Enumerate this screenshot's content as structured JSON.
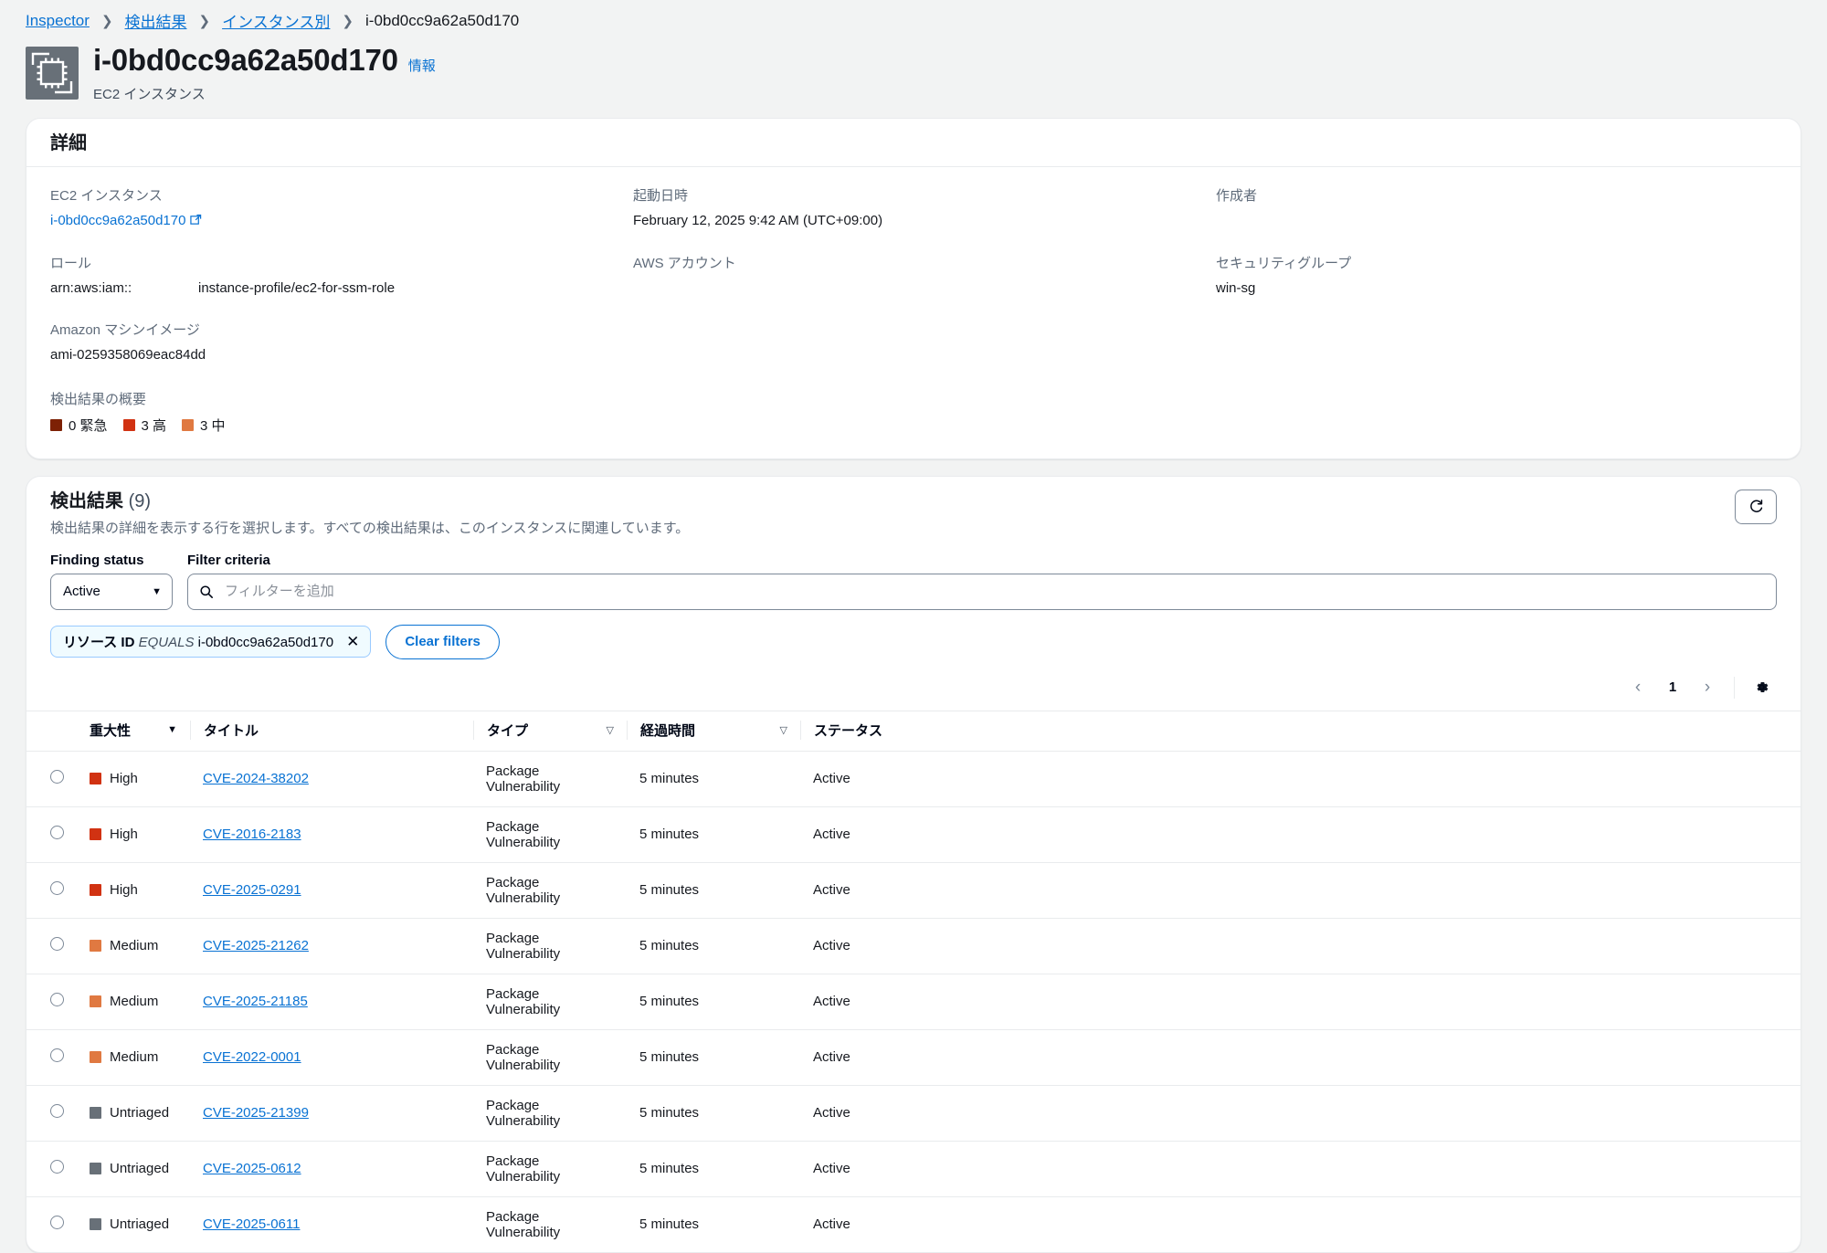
{
  "breadcrumb": [
    {
      "label": "Inspector",
      "link": true
    },
    {
      "label": "検出結果",
      "link": true
    },
    {
      "label": "インスタンス別",
      "link": true
    },
    {
      "label": "i-0bd0cc9a62a50d170",
      "link": false
    }
  ],
  "header": {
    "icon": "ec2-instance-icon",
    "title": "i-0bd0cc9a62a50d170",
    "info_label": "情報",
    "subtitle": "EC2 インスタンス"
  },
  "details": {
    "section_title": "詳細",
    "fields": [
      {
        "label": "EC2 インスタンス",
        "value": "i-0bd0cc9a62a50d170",
        "is_link": true,
        "external": true
      },
      {
        "label": "起動日時",
        "value": "February 12, 2025 9:42 AM (UTC+09:00)"
      },
      {
        "label": "作成者",
        "value": ""
      },
      {
        "label": "ロール",
        "value_prefix": "arn:aws:iam::",
        "value_suffix": "instance-profile/ec2-for-ssm-role"
      },
      {
        "label": "AWS アカウント",
        "value": ""
      },
      {
        "label": "セキュリティグループ",
        "value": "win-sg"
      },
      {
        "label": "Amazon マシンイメージ",
        "value": "ami-0259358069eac84dd"
      }
    ],
    "summary": {
      "label": "検出結果の概要",
      "severities": [
        {
          "count": "0",
          "label": "緊急",
          "color": "#7d2105"
        },
        {
          "count": "3",
          "label": "高",
          "color": "#d13212"
        },
        {
          "count": "3",
          "label": "中",
          "color": "#e07941"
        }
      ]
    }
  },
  "findings": {
    "title": "検出結果",
    "count": "(9)",
    "description": "検出結果の詳細を表示する行を選択します。すべての検出結果は、このインスタンスに関連しています。",
    "refresh_icon": "refresh-icon",
    "filters": {
      "status_label": "Finding status",
      "status_value": "Active",
      "criteria_label": "Filter criteria",
      "search_placeholder": "フィルターを追加",
      "search_value": "",
      "search_icon": "search-icon",
      "token": {
        "key": "リソース ID",
        "operator": "EQUALS",
        "value": "i-0bd0cc9a62a50d170",
        "remove_icon": "close-icon"
      },
      "clear_label": "Clear filters"
    },
    "pagination": {
      "prev_icon": "chevron-left-icon",
      "page": "1",
      "next_icon": "chevron-right-icon",
      "settings_icon": "gear-icon"
    },
    "columns": [
      {
        "label": "重大性",
        "sortable": true,
        "sorted": true
      },
      {
        "label": "タイトル",
        "sortable": false,
        "sorted": false
      },
      {
        "label": "タイプ",
        "sortable": true,
        "sorted": false
      },
      {
        "label": "経過時間",
        "sortable": true,
        "sorted": false
      },
      {
        "label": "ステータス",
        "sortable": false,
        "sorted": false
      }
    ],
    "severity_colors": {
      "High": "#d13212",
      "Medium": "#e07941",
      "Untriaged": "#687078"
    },
    "rows": [
      {
        "severity": "High",
        "title": "CVE-2024-38202",
        "type": "Package Vulnerability",
        "age": "5 minutes",
        "status": "Active"
      },
      {
        "severity": "High",
        "title": "CVE-2016-2183",
        "type": "Package Vulnerability",
        "age": "5 minutes",
        "status": "Active"
      },
      {
        "severity": "High",
        "title": "CVE-2025-0291",
        "type": "Package Vulnerability",
        "age": "5 minutes",
        "status": "Active"
      },
      {
        "severity": "Medium",
        "title": "CVE-2025-21262",
        "type": "Package Vulnerability",
        "age": "5 minutes",
        "status": "Active"
      },
      {
        "severity": "Medium",
        "title": "CVE-2025-21185",
        "type": "Package Vulnerability",
        "age": "5 minutes",
        "status": "Active"
      },
      {
        "severity": "Medium",
        "title": "CVE-2022-0001",
        "type": "Package Vulnerability",
        "age": "5 minutes",
        "status": "Active"
      },
      {
        "severity": "Untriaged",
        "title": "CVE-2025-21399",
        "type": "Package Vulnerability",
        "age": "5 minutes",
        "status": "Active"
      },
      {
        "severity": "Untriaged",
        "title": "CVE-2025-0612",
        "type": "Package Vulnerability",
        "age": "5 minutes",
        "status": "Active"
      },
      {
        "severity": "Untriaged",
        "title": "CVE-2025-0611",
        "type": "Package Vulnerability",
        "age": "5 minutes",
        "status": "Active"
      }
    ]
  }
}
